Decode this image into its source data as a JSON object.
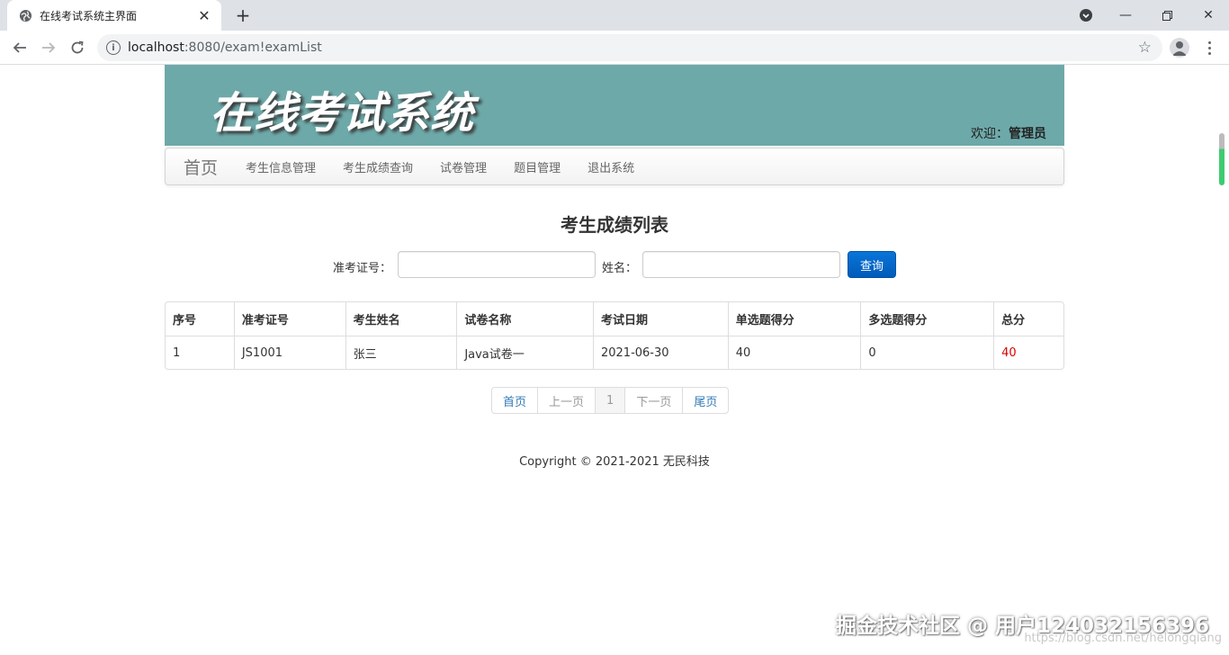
{
  "browser": {
    "tab_title": "在线考试系统主界面",
    "url_host": "localhost",
    "url_path": ":8080/exam!examList"
  },
  "header": {
    "logo_text": "在线考试系统",
    "welcome_label": "欢迎：",
    "welcome_user": "管理员"
  },
  "nav": {
    "brand": "首页",
    "items": [
      {
        "label": "考生信息管理"
      },
      {
        "label": "考生成绩查询"
      },
      {
        "label": "试卷管理"
      },
      {
        "label": "题目管理"
      },
      {
        "label": "退出系统"
      }
    ]
  },
  "main": {
    "title": "考生成绩列表",
    "search": {
      "id_label": "准考证号：",
      "id_value": "",
      "name_label": "姓名：",
      "name_value": "",
      "button": "查询"
    },
    "table": {
      "headers": [
        "序号",
        "准考证号",
        "考生姓名",
        "试卷名称",
        "考试日期",
        "单选题得分",
        "多选题得分",
        "总分"
      ],
      "rows": [
        [
          "1",
          "JS1001",
          "张三",
          "Java试卷一",
          "2021-06-30",
          "40",
          "0",
          "40"
        ]
      ]
    },
    "pagination": {
      "first": "首页",
      "prev": "上一页",
      "current": "1",
      "next": "下一页",
      "last": "尾页"
    }
  },
  "footer": {
    "copyright": "Copyright © 2021-2021 无民科技"
  },
  "watermark": {
    "text": "掘金技术社区 @ 用户124032156396",
    "url": "https://blog.csdn.net/helongqiang"
  },
  "colors": {
    "banner": "#6ea9a9",
    "link": "#337ab7",
    "query_button": "#0067c8",
    "total_score": "#dd0000"
  }
}
